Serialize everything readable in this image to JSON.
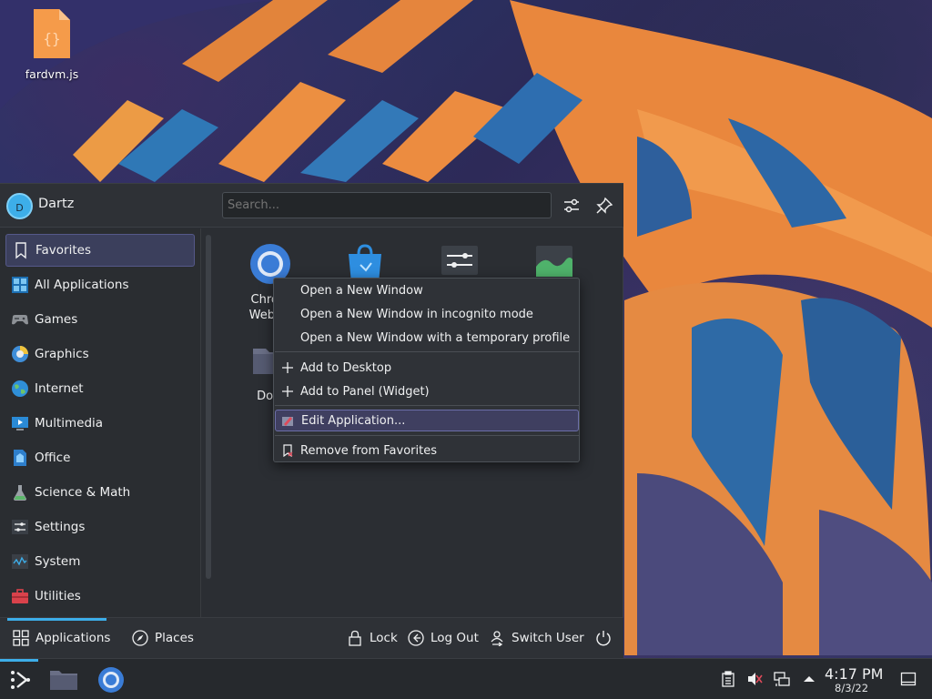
{
  "desktop": {
    "icons": [
      {
        "label": "fardvm.js",
        "icon": "javascript-file-icon"
      }
    ]
  },
  "launcher": {
    "user": {
      "initial": "D",
      "name": "Dartz"
    },
    "search": {
      "placeholder": "Search..."
    },
    "header_buttons": [
      "configure-icon",
      "pin-icon"
    ],
    "categories": [
      {
        "label": "Favorites",
        "icon": "bookmark-icon",
        "active": true
      },
      {
        "label": "All Applications",
        "icon": "all-applications-icon"
      },
      {
        "label": "Games",
        "icon": "games-icon"
      },
      {
        "label": "Graphics",
        "icon": "graphics-icon"
      },
      {
        "label": "Internet",
        "icon": "internet-icon"
      },
      {
        "label": "Multimedia",
        "icon": "multimedia-icon"
      },
      {
        "label": "Office",
        "icon": "office-icon"
      },
      {
        "label": "Science & Math",
        "icon": "science-icon"
      },
      {
        "label": "Settings",
        "icon": "settings-icon"
      },
      {
        "label": "System",
        "icon": "system-icon"
      },
      {
        "label": "Utilities",
        "icon": "utilities-icon"
      }
    ],
    "favorites": [
      {
        "label_line1": "Chrom",
        "label_line2": "Web Br",
        "icon": "chromium-icon"
      },
      {
        "label_line1": "",
        "label_line2": "",
        "icon": "discover-icon"
      },
      {
        "label_line1": "",
        "label_line2": "",
        "icon": "system-settings-icon"
      },
      {
        "label_line1": "",
        "label_line2": "",
        "icon": "system-monitor-icon"
      },
      {
        "label_line1": "Dolp",
        "label_line2": "",
        "icon": "dolphin-folder-icon"
      }
    ],
    "footer": {
      "tabs": [
        {
          "label": "Applications",
          "icon": "applications-grid-icon",
          "active": true
        },
        {
          "label": "Places",
          "icon": "compass-icon"
        }
      ],
      "actions": [
        {
          "label": "Lock",
          "icon": "lock-icon"
        },
        {
          "label": "Log Out",
          "icon": "logout-icon"
        },
        {
          "label": "Switch User",
          "icon": "switch-user-icon"
        }
      ],
      "power_icon": "power-icon"
    }
  },
  "context_menu": {
    "groups": [
      [
        {
          "label": "Open a New Window"
        },
        {
          "label": "Open a New Window in incognito mode"
        },
        {
          "label": "Open a New Window with a temporary profile"
        }
      ],
      [
        {
          "label": "Add to Desktop",
          "icon": "plus-icon"
        },
        {
          "label": "Add to Panel (Widget)",
          "icon": "plus-icon"
        }
      ],
      [
        {
          "label": "Edit Application...",
          "icon": "edit-application-icon",
          "highlighted": true
        }
      ],
      [
        {
          "label": "Remove from Favorites",
          "icon": "remove-bookmark-icon"
        }
      ]
    ]
  },
  "taskbar": {
    "launcher_icon": "kde-launcher-icon",
    "tasks": [
      "dolphin-folder-icon",
      "chromium-icon"
    ],
    "tray": [
      "clipboard-icon",
      "volume-muted-icon",
      "network-wired-icon",
      "tray-expand-icon"
    ],
    "clock": {
      "time": "4:17 PM",
      "date": "8/3/22"
    },
    "show_desktop_icon": "show-desktop-icon"
  },
  "colors": {
    "accent": "#3daee9",
    "panel_bg": "#2b2e33",
    "highlight": "#3f3f60"
  }
}
